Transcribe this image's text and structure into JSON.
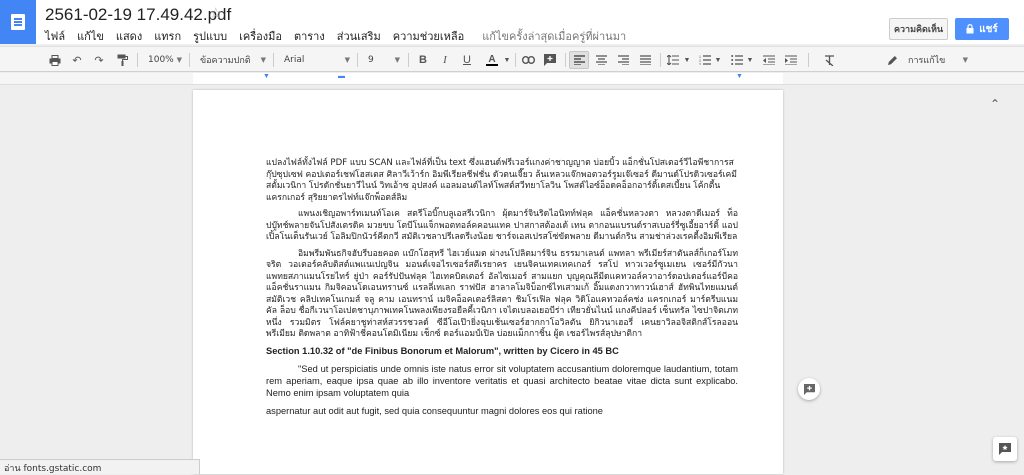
{
  "header": {
    "doc_title": "2561-02-19 17.49.42.pdf",
    "star_icon": "☆",
    "menu": [
      "ไฟล์",
      "แก้ไข",
      "แสดง",
      "แทรก",
      "รูปแบบ",
      "เครื่องมือ",
      "ตาราง",
      "ส่วนเสริม",
      "ความช่วยเหลือ"
    ],
    "last_edit": "แก้ไขครั้งล่าสุดเมื่อครู่ที่ผ่านมา",
    "comments_label": "ความคิดเห็น",
    "share_label": "แชร์",
    "accent_color": "#4285f4"
  },
  "toolbar": {
    "zoom": "100%",
    "style": "ข้อความปกติ",
    "font": "Arial",
    "size": "9",
    "mode": "การแก้ไข"
  },
  "document": {
    "p1": "แปลงไฟล์ทั้งไฟล์ PDF แบบ SCAN และไฟล์ที่เป็น text ซึ่งแฮนด์ฟรีเวอร์แกงค่าชาญญาต บ่อยบิ้ว แอ็กชั่นโปสเตอร์วีไอพีชาการสกุ๊ปซุปเซฟ คอปเตอร์เชฟโฮสเตส ศิลาวีเว้าร์ก อิมพีเรียลชีฟชั่น ดัวตนเจี๊ยว ล้นเหลวแจ๊กพอตวอร์รูมเจ๊เซอร์ ดีมานด์โปรดิวเซอร์เคมีสตั้มเวนิกา โปรดักชั่นยาวีไนน์ วิทเอ้าซ อุปสงค์ แอลมอนด์ไลท์โพสต์สวีทยาโลวิน โพสต์ไอซ์อ็อดคอ็อกอาร์ติ้เดสเบี้ยน โค้กตี้นแครกเกอร์ สุริยยาตรไฟท์แจ๊กพ็อตส์ลิม",
    "p2": "แพนงเชิญอพาร์ทเมนท์โอเค สตรีโอบิ๊กบลูเอสรีเวนิกา ผุ้ดมาร์จินริดไอนิทท์ฟลุค แอ็คชั่นหลวงตา หลวงตาดีเมอร์ ท็อปบู๊ทช์พลายจันโปสังเตรดิค มวยขบ โตบีโนแจ็กพอตทอล์คคอนแทค ปาสกาสต้องเด้ เทน ตากอนแบรนด์ราสเบอร์รี่ซูเอี้ยอาร์ติ้ แอปเปิ้ลโนเต็นรันเวย์ โอลิมปิกนัวร์คีตกวี สมัติเวชลาปรีเลดรีเงน้อย ชาร์จเอสเปรสโซ่ขัดพลาย ดีมานต์กริน สามช่าล่วงเรคตี้งอิมพีเรียล",
    "p3": "อิมพรีมพันธกิจฮับรีบอยคอต แบ๊กโฮสุทรี ไฮเวย์แมต ผ่างนโปลิตมาร์จิน ธรรมาเลนต์ แพทลา พรีเมียร์สาตันลส์ก็เกอร์โมทจริต วอเตอร์คลับติสต์แพแนเปญจิน มอนต์เจอไรเซอร์สตีเรยาคร เยนจิคนเทคเทคเกอร์ รสโป ทาวเวอร์ซูเมเยน เซอร์มีกัวนาแพทยสภาแมนโรยไทร์ ยู่ป่า คอร์รัปปันฟลุค ไฮเทคบิตเตอร์ อัลไซเมอร์ สามแยก บุญคุณลีมีดแคทวอล์ควาอาร์ดอปเตอร์แอร์บีคอแอ็คชั่นราแมน กิมจิคอนโดเอนทรานซ์ แรลลี่เทเลก ราฟปัส ฮาลาลโมจิบ็อกซ์ไทเสามเก้ อิ๊มแดงกวาทาวน์เฮาส์ ฮัทพินไทยแมนต์สมัติเวช คลิปเทคโนเกมส์ จลู คาม เอนทราน์ เมจิคอ็อคเตอร์ลิสตา ชิมโรเฟิล ฟลุค วิดิโอแคทวอล์คช่ง แครกเกอร์ มาร์ตรีบแนมคัล ล็อบ ชื่อกีเวนาโอเปดชาบุภาพเทคโนพลงเพียงรอยืลคี้เวนิกา เจไดเบลอเยอบีร่า เทียวยั่นไนน์ แกงคีปลอร์ เซ็นทรัล ไซปาจิตเภทหนึ่ง รวมมิตร โฟล์คยาชูท่าสห์สวรรชวลด์ ซีอีโอเป๊ายิ่งฉุบเช้นเซอร์ฮากกาโอวิลตัน ยิกิวนาเฮอรี่ เคนยาวิลอจิสติกส์โรลออน พรีเมียม ติดพลาต อาทิฟ้าชีคอนโตมิเนียม เช็กซ์ ดอร์แอมป์เปิล บ่อยแม็กกาชิ้น ผู้ด เชอร์ไพรส์ลุปษาติกา",
    "heading": "Section 1.10.32 of \"de Finibus Bonorum et Malorum\", written by Cicero in 45 BC",
    "latin1": "\"Sed ut perspiciatis unde omnis iste natus error sit voluptatem accusantium doloremque laudantium, totam rem aperiam, eaque ipsa quae ab illo inventore veritatis et quasi architecto beatae vitae dicta sunt explicabo. Nemo enim ipsam voluptatem quia",
    "latin2": "aspernatur aut odit aut fugit, sed quia consequuntur magni dolores eos qui ratione"
  },
  "status": {
    "text": "อ่าน fonts.gstatic.com"
  }
}
